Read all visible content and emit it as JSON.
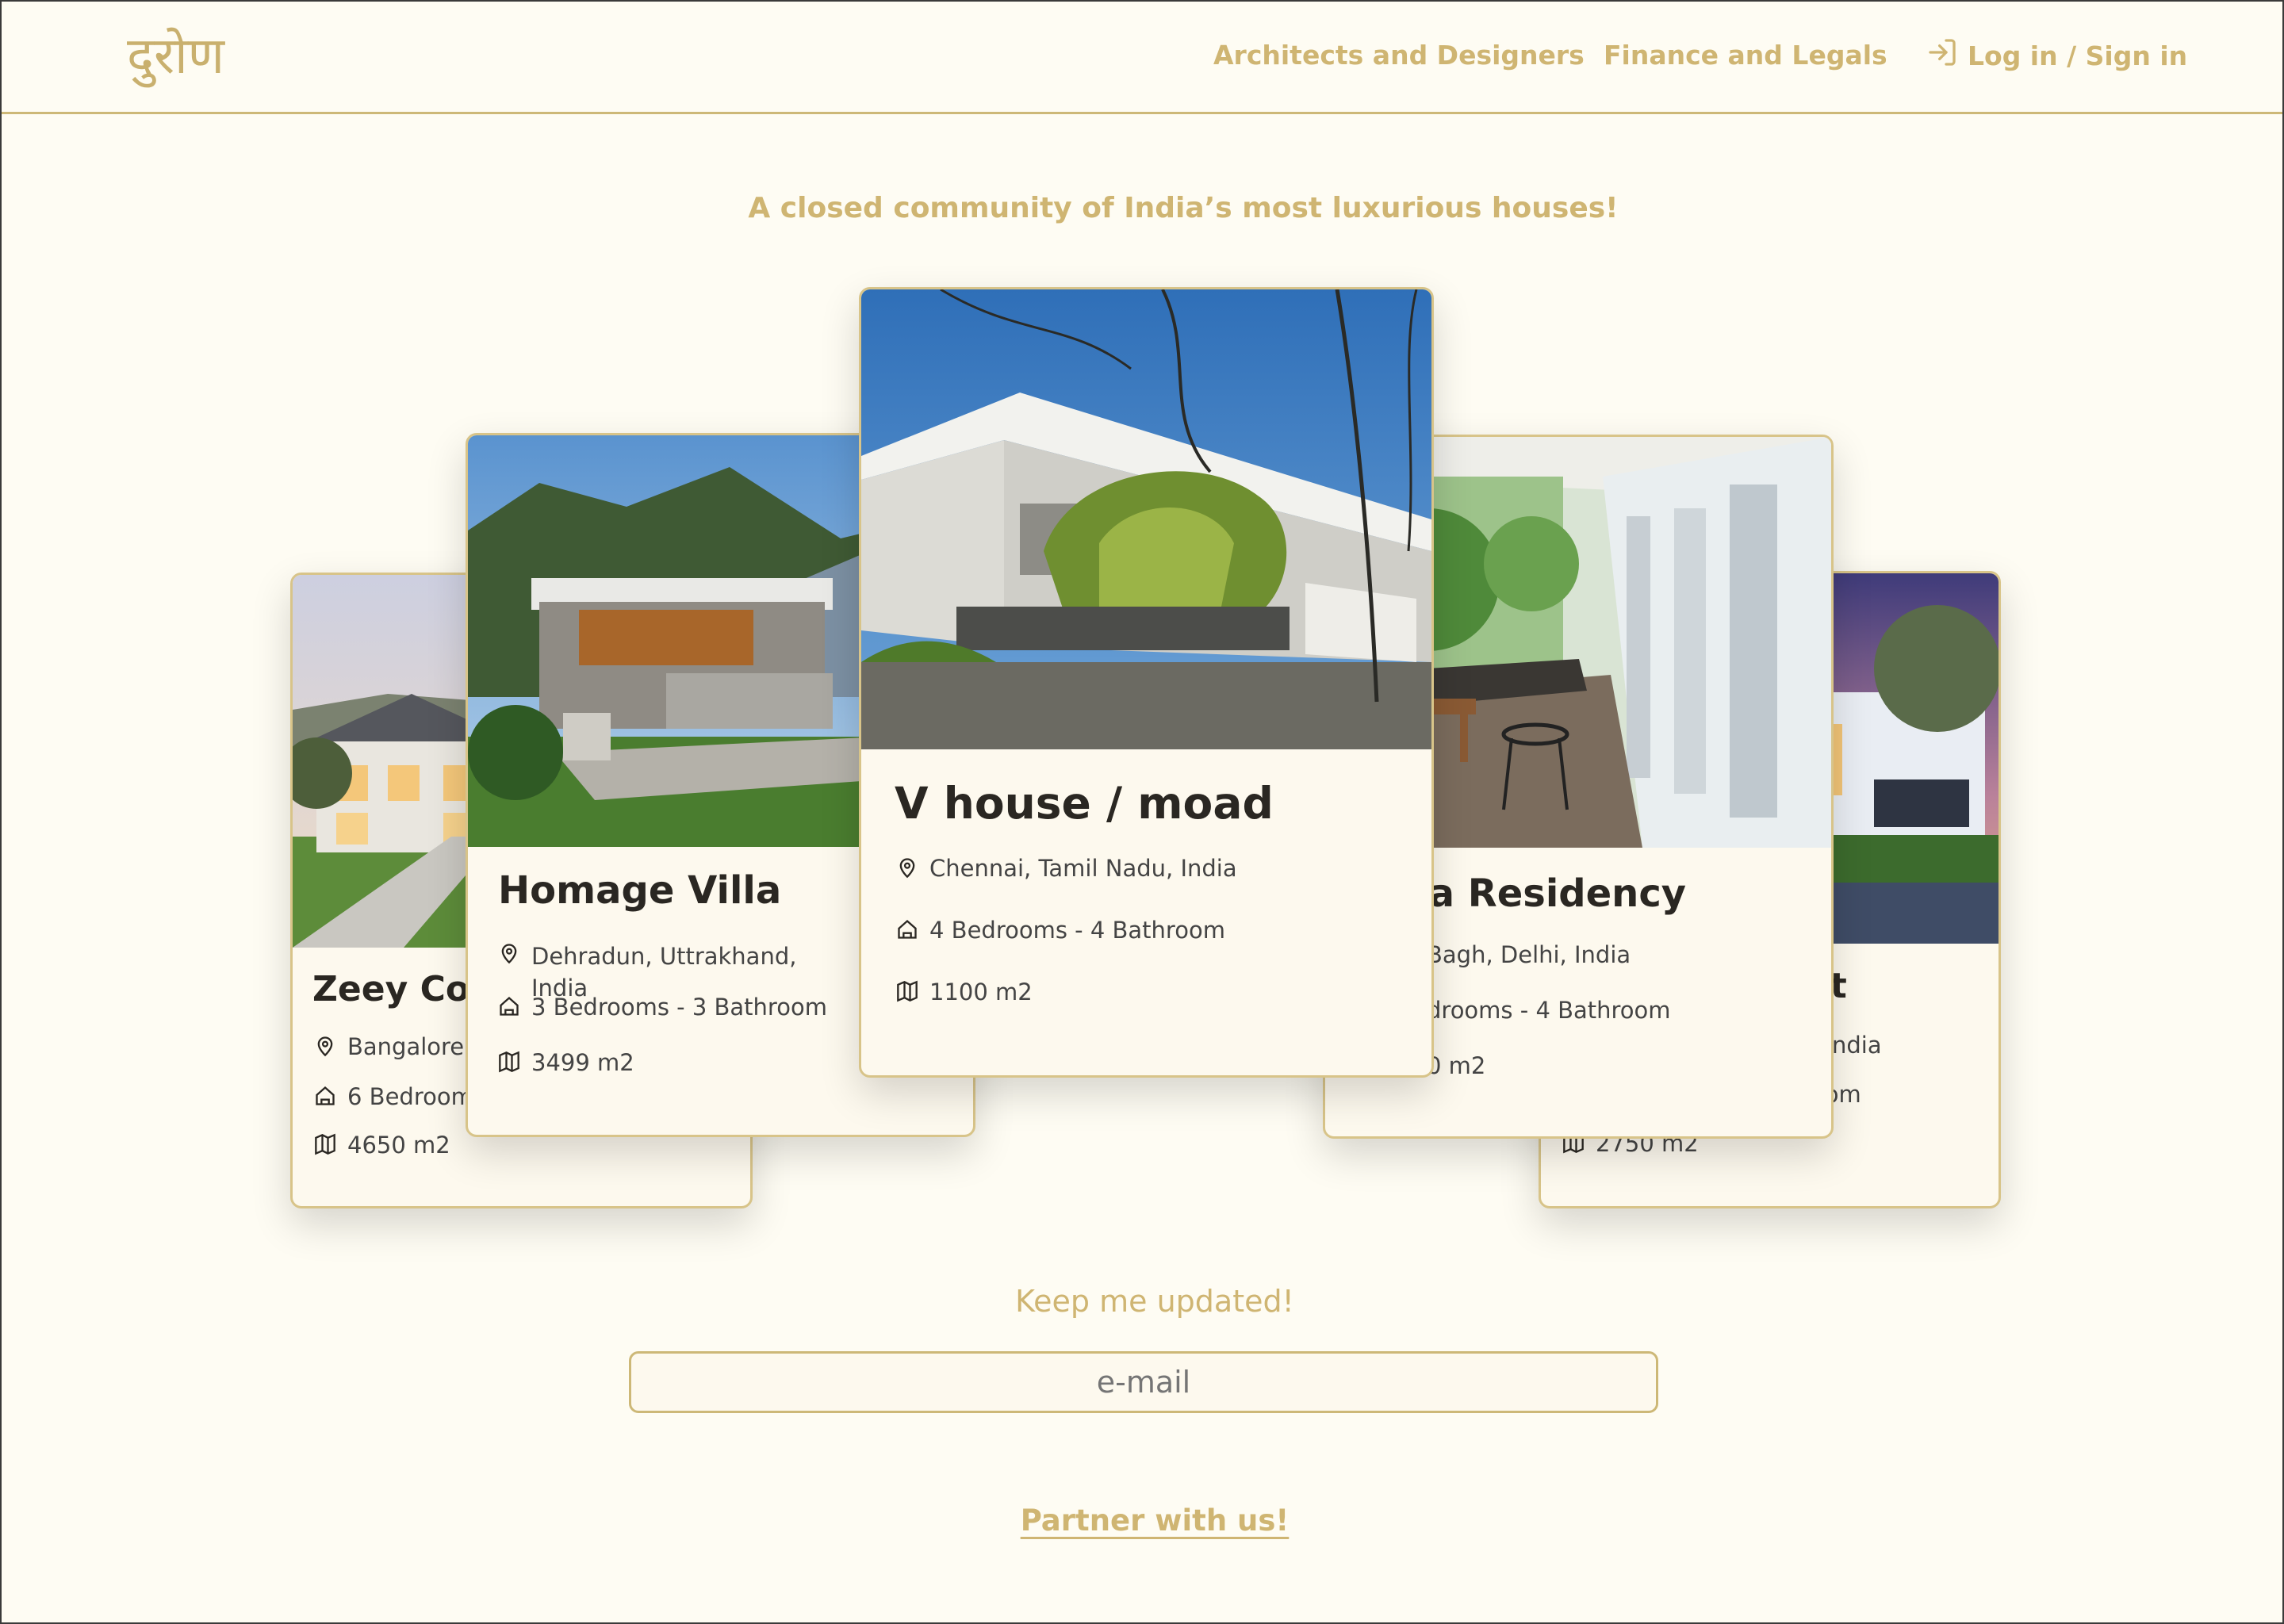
{
  "nav": {
    "logo": "दुरोण",
    "links": [
      "Architects and Designers",
      "Finance and Legals"
    ],
    "login": "Log in / Sign in",
    "login_icon": "login-icon"
  },
  "hero": {
    "tagline": "A closed community of India’s most luxurious houses!"
  },
  "cards": [
    {
      "title": "Zeey Cor",
      "location": "Bangalore,",
      "rooms": "6 Bedroom",
      "area": "4650 m2"
    },
    {
      "title": "Homage Villa",
      "location": "Dehradun, Uttrakhand, India",
      "rooms": "3 Bedrooms - 3 Bathroom",
      "area": "3499 m2"
    },
    {
      "title": "V house / moad",
      "location": "Chennai, Tamil Nadu, India",
      "rooms": "4 Bedrooms - 4 Bathroom",
      "area": "1100 m2"
    },
    {
      "title": "nia Residency",
      "location": "Bagh, Delhi, India",
      "rooms": "drooms - 4 Bathroom",
      "area": "0 m2"
    },
    {
      "title": "at",
      "location": ", India",
      "rooms": "oom",
      "area": "2750 m2"
    }
  ],
  "newsletter": {
    "heading": "Keep me updated!",
    "placeholder": "e-mail"
  },
  "footer": {
    "partner": "Partner with us!"
  },
  "colors": {
    "accent": "#cfb572",
    "background": "#fefcf3",
    "card_border": "#d8c489",
    "text": "#2a2722"
  },
  "icons": [
    "location-pin-icon",
    "house-icon",
    "map-icon",
    "login-icon"
  ]
}
